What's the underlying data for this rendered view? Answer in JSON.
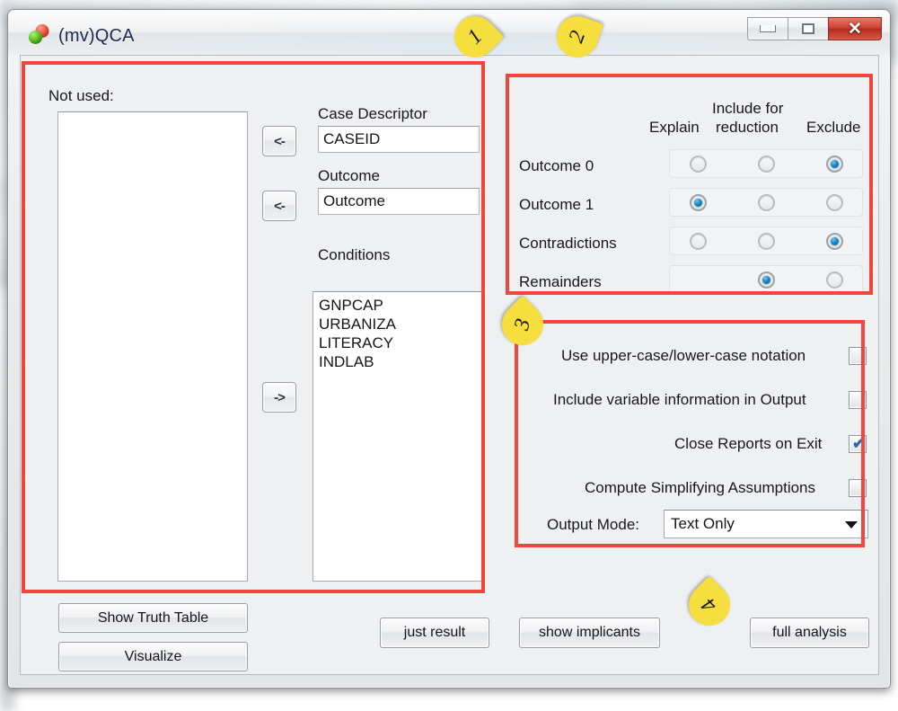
{
  "window": {
    "title": "(mv)QCA",
    "app_icon": "qca-spheres-icon",
    "controls": {
      "minimize": "minimize-button",
      "maximize": "maximize-button",
      "close_glyph": "✕"
    }
  },
  "left_panel": {
    "not_used_label": "Not used:",
    "not_used_items": [],
    "move_left_case_button": "<-",
    "move_left_outcome_button": "<-",
    "move_right_conditions_button": "->",
    "case_descriptor_label": "Case Descriptor",
    "case_descriptor_value": "CASEID",
    "outcome_label": "Outcome",
    "outcome_value": "Outcome",
    "conditions_label": "Conditions",
    "conditions_items": [
      "GNPCAP",
      "URBANIZA",
      "LITERACY",
      "INDLAB"
    ]
  },
  "inclusion_panel": {
    "columns": [
      "Explain",
      "Include for reduction",
      "Exclude"
    ],
    "column_lines": [
      [
        "",
        "Explain"
      ],
      [
        "Include for",
        "reduction"
      ],
      [
        "",
        "Exclude"
      ]
    ],
    "rows": [
      {
        "label": "Outcome 0",
        "cells": [
          "off",
          "off",
          "on"
        ]
      },
      {
        "label": "Outcome 1",
        "cells": [
          "on",
          "off",
          "off"
        ]
      },
      {
        "label": "Contradictions",
        "cells": [
          "off",
          "off",
          "on"
        ]
      },
      {
        "label": "Remainders",
        "cells": [
          "none",
          "on",
          "off"
        ]
      }
    ]
  },
  "options_panel": {
    "checkboxes": [
      {
        "label": "Use upper-case/lower-case notation",
        "checked": false
      },
      {
        "label": "Include variable information in Output",
        "checked": false
      },
      {
        "label": "Close Reports on Exit",
        "checked": true
      },
      {
        "label": "Compute Simplifying Assumptions",
        "checked": false
      }
    ],
    "check_glyph": "✔",
    "output_mode_label": "Output Mode:",
    "output_mode_value": "Text Only",
    "output_mode_options": [
      "Text Only"
    ]
  },
  "buttons": {
    "show_truth_table": "Show Truth Table",
    "visualize": "Visualize",
    "just_result": "just result",
    "show_implicants": "show implicants",
    "full_analysis": "full analysis"
  },
  "annotations": {
    "boxes": [
      "region-1",
      "region-2",
      "region-3"
    ],
    "callouts": [
      {
        "number": "1"
      },
      {
        "number": "2"
      },
      {
        "number": "3"
      },
      {
        "number": "4"
      }
    ]
  },
  "colors": {
    "annotation_red": "#f2453b",
    "callout_yellow": "#f7de3f",
    "radio_blue": "#1b86c8",
    "check_blue": "#2a62b4",
    "title_text": "#1c2a52",
    "close_red": "#cf4433"
  }
}
